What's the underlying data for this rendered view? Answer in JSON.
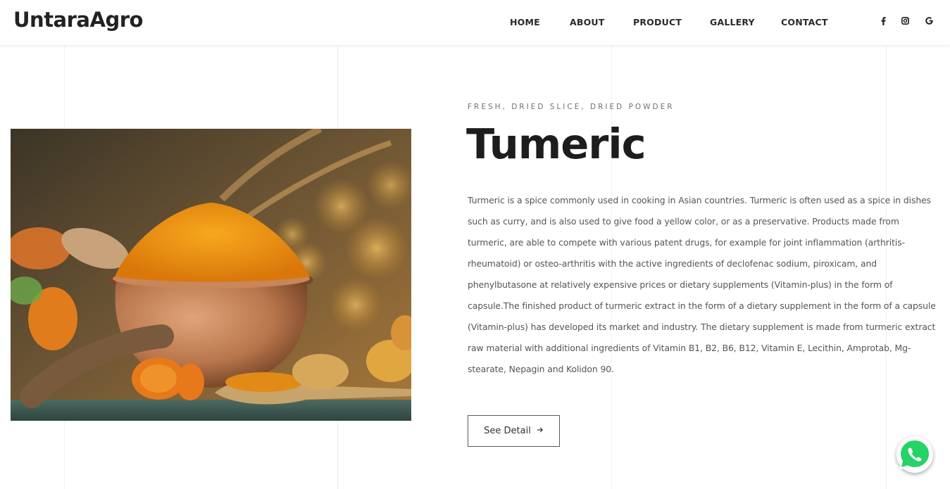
{
  "header": {
    "logo": "UntaraAgro",
    "nav": [
      {
        "label": "HOME"
      },
      {
        "label": "ABOUT"
      },
      {
        "label": "PRODUCT"
      },
      {
        "label": "GALLERY"
      },
      {
        "label": "CONTACT"
      }
    ],
    "social": [
      "facebook-icon",
      "instagram-icon",
      "google-icon"
    ]
  },
  "product": {
    "subtitle": "FRESH, DRIED SLICE, DRIED POWDER",
    "title": "Tumeric",
    "description": "Turmeric is a spice commonly used in cooking in Asian countries. Turmeric is often used as a spice in dishes such as curry, and is also used to give food a yellow color, or as a preservative. Products made from turmeric, are able to compete with various patent drugs, for example for joint inflammation (arthritis-rheumatoid) or osteo-arthritis with the active ingredients of declofenac sodium, piroxicam, and phenylbutasone at relatively expensive prices or dietary supplements (Vitamin-plus) in the form of capsule.The finished product of turmeric extract in the form of a dietary supplement in the form of a capsule (Vitamin-plus) has developed its market and industry. The dietary supplement is made from turmeric extract raw material with additional ingredients of Vitamin B1, B2, B6, B12, Vitamin E, Lecithin, Amprotab, Mg-stearate, Nepagin and Kolidon 90.",
    "button_label": "See Detail",
    "button_icon": "arrow-right-icon"
  },
  "floating": {
    "icon": "whatsapp-icon"
  },
  "colors": {
    "accent": "#e58a0e",
    "whatsapp": "#25d366",
    "text": "#222222"
  }
}
